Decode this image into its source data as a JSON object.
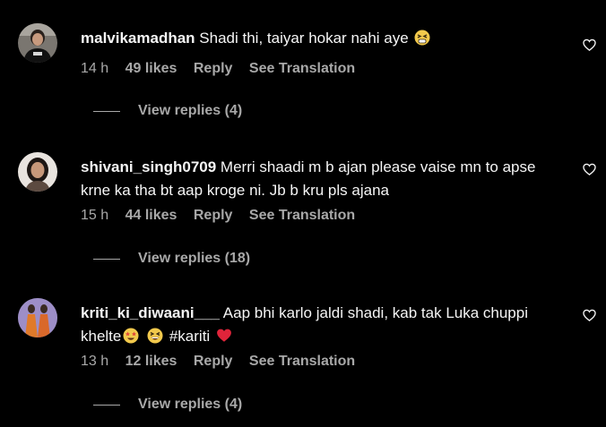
{
  "comments": [
    {
      "username": "malvikamadhan",
      "text": "Shadi thi, taiyar hokar nahi aye",
      "emojis": [
        "tired-face-emoji"
      ],
      "time": "14 h",
      "likes": "49 likes",
      "reply_label": "Reply",
      "translate_label": "See Translation",
      "view_replies": "View replies (4)"
    },
    {
      "username": "shivani_singh0709",
      "text": "Merri shaadi m b ajan please vaise mn to apse krne ka tha bt aap kroge ni. Jb b kru pls ajana",
      "time": "15 h",
      "likes": "44 likes",
      "reply_label": "Reply",
      "translate_label": "See Translation",
      "view_replies": "View replies (18)"
    },
    {
      "username": "kriti_ki_diwaani___",
      "text_part1": "Aap bhi karlo jaldi shadi, kab tak Luka chuppi khelte",
      "hashtag": "#kariti",
      "emojis": [
        "star-struck-emoji",
        "grinning-squint-emoji",
        "red-heart-emoji"
      ],
      "time": "13 h",
      "likes": "12 likes",
      "reply_label": "Reply",
      "translate_label": "See Translation",
      "view_replies": "View replies (4)"
    }
  ],
  "colors": {
    "background": "#000000",
    "text": "#f5f5f5",
    "muted": "#a8a8a8"
  },
  "icons": {
    "like": "heart-outline-icon"
  }
}
